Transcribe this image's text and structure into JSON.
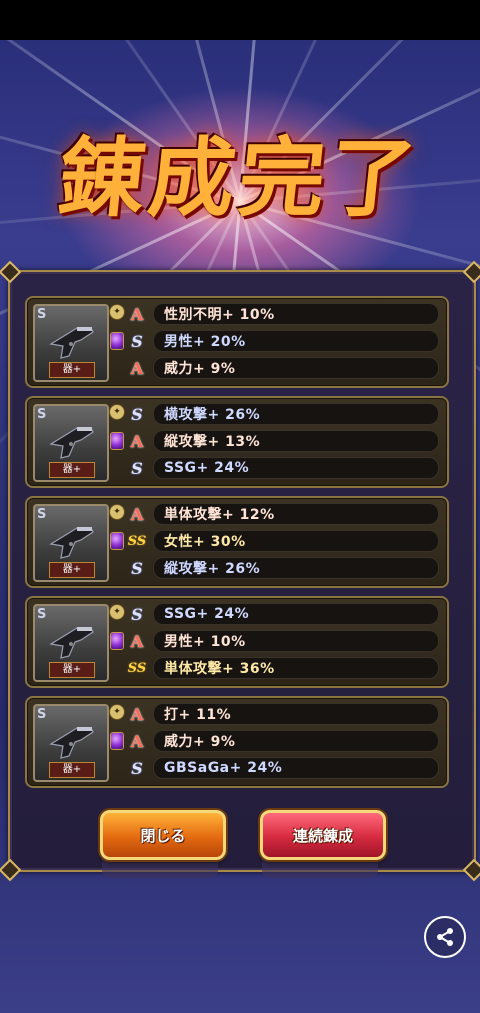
{
  "title": "錬成完了",
  "cards": [
    {
      "weapon_tag": "器+",
      "weapon_slot": "S",
      "rows": [
        {
          "rank": "A",
          "text": "性別不明+ 10%"
        },
        {
          "rank": "S",
          "text": "男性+ 20%"
        },
        {
          "rank": "A",
          "text": "威力+ 9%"
        }
      ]
    },
    {
      "weapon_tag": "器+",
      "weapon_slot": "S",
      "rows": [
        {
          "rank": "S",
          "text": "横攻撃+ 26%"
        },
        {
          "rank": "A",
          "text": "縦攻撃+ 13%"
        },
        {
          "rank": "S",
          "text": "SSG+ 24%"
        }
      ]
    },
    {
      "weapon_tag": "器+",
      "weapon_slot": "S",
      "rows": [
        {
          "rank": "A",
          "text": "単体攻撃+ 12%"
        },
        {
          "rank": "SS",
          "text": "女性+ 30%"
        },
        {
          "rank": "S",
          "text": "縦攻撃+ 26%"
        }
      ]
    },
    {
      "weapon_tag": "器+",
      "weapon_slot": "S",
      "rows": [
        {
          "rank": "S",
          "text": "SSG+ 24%"
        },
        {
          "rank": "A",
          "text": "男性+ 10%"
        },
        {
          "rank": "SS",
          "text": "単体攻撃+ 36%"
        }
      ]
    },
    {
      "weapon_tag": "器+",
      "weapon_slot": "S",
      "rows": [
        {
          "rank": "A",
          "text": "打+ 11%"
        },
        {
          "rank": "A",
          "text": "威力+ 9%"
        },
        {
          "rank": "S",
          "text": "GBSaGa+ 24%"
        }
      ]
    }
  ],
  "buttons": {
    "close_label": "閉じる",
    "repeat_label": "連続錬成"
  },
  "icons": {
    "share": "share-icon",
    "gear": "gear-icon",
    "gem": "gem-icon",
    "gun": "pistol-icon"
  },
  "colors": {
    "rank_A": "#ff6a55",
    "rank_S": "#dde2ff",
    "rank_SS": "#ffd54a",
    "close_button": "#e36a10",
    "repeat_button": "#d62a40"
  }
}
